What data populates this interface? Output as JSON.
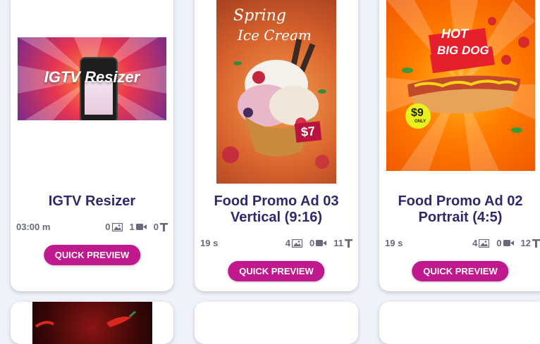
{
  "cards": [
    {
      "title_line1": "IGTV Resizer",
      "title_line2": "",
      "thumb_text": "IGTV Resizer",
      "duration": "03:00 m",
      "images": "0",
      "videos": "1",
      "texts": "0",
      "button": "QUICK PREVIEW"
    },
    {
      "title_line1": "Food Promo Ad 03",
      "title_line2": "Vertical (9:16)",
      "thumb_text_line1": "Spring",
      "thumb_text_line2": "Ice Cream",
      "price": "$7",
      "duration": "19 s",
      "images": "4",
      "videos": "0",
      "texts": "11",
      "button": "QUICK PREVIEW"
    },
    {
      "title_line1": "Food Promo Ad 02",
      "title_line2": "Portrait (4:5)",
      "thumb_text_line1": "HOT",
      "thumb_text_line2": "BIG DOG",
      "price": "$9",
      "price_sub": "ONLY",
      "duration": "19 s",
      "images": "4",
      "videos": "0",
      "texts": "12",
      "button": "QUICK PREVIEW"
    }
  ],
  "colors": {
    "title": "#2c2a6b",
    "button": "#c0198e",
    "background": "#eef2f9"
  },
  "icons": {
    "images": "image-icon",
    "videos": "video-camera-icon",
    "texts": "text-icon"
  }
}
